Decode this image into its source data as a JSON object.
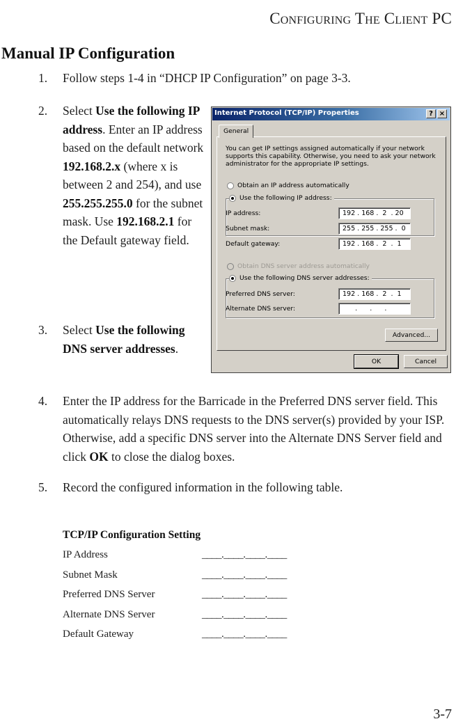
{
  "running_head": "Configuring The Client PC",
  "section_title": "Manual IP Configuration",
  "steps": [
    {
      "num": "1.",
      "parts": [
        {
          "t": "Follow steps 1-4 in “DHCP IP Configuration” on page 3-3."
        }
      ]
    },
    {
      "num": "2.",
      "parts": [
        {
          "t": "Select "
        },
        {
          "t": "Use the following IP address",
          "b": true
        },
        {
          "t": ". Enter an IP address based on the default network "
        },
        {
          "t": "192.168.2.x",
          "b": true
        },
        {
          "t": " (where x is between 2 and 254), and use "
        },
        {
          "t": "255.255.255.0",
          "b": true
        },
        {
          "t": " for the subnet mask. Use "
        },
        {
          "t": "192.168.2.1",
          "b": true
        },
        {
          "t": " for the Default gateway field."
        }
      ]
    },
    {
      "num": "3.",
      "parts": [
        {
          "t": "Select "
        },
        {
          "t": "Use the following DNS server addresses",
          "b": true
        },
        {
          "t": "."
        }
      ]
    },
    {
      "num": "4.",
      "parts": [
        {
          "t": "Enter the IP address for the Barricade in the Preferred DNS server field. This automatically relays DNS requests to the DNS server(s) provided by your ISP. Otherwise, add a specific DNS server into the Alternate DNS Server field and click "
        },
        {
          "t": "OK",
          "b": true
        },
        {
          "t": " to close the dialog boxes."
        }
      ]
    },
    {
      "num": "5.",
      "parts": [
        {
          "t": "Record the configured information in the following table."
        }
      ]
    }
  ],
  "dialog": {
    "title": "Internet Protocol (TCP/IP) Properties",
    "help_glyph": "?",
    "close_glyph": "×",
    "tab_label": "General",
    "intro": "You can get IP settings assigned automatically if your network supports this capability. Otherwise, you need to ask your network administrator for the appropriate IP settings.",
    "radio_obtain_ip": {
      "label": "Obtain an IP address automatically",
      "checked": false
    },
    "radio_use_ip": {
      "label": "Use the following IP address:",
      "checked": true
    },
    "ip_fields": [
      {
        "label": "IP address:",
        "value": "192 . 168 .  2  . 20"
      },
      {
        "label": "Subnet mask:",
        "value": "255 . 255 . 255 .  0"
      },
      {
        "label": "Default gateway:",
        "value": "192 . 168 .  2  .  1"
      }
    ],
    "radio_obtain_dns": {
      "label": "Obtain DNS server address automatically",
      "checked": false,
      "disabled": true
    },
    "radio_use_dns": {
      "label": "Use the following DNS server addresses:",
      "checked": true
    },
    "dns_fields": [
      {
        "label": "Preferred DNS server:",
        "value": "192 . 168 .  2  .  1"
      },
      {
        "label": "Alternate DNS server:",
        "value": "      .      .      ."
      }
    ],
    "advanced_label": "Advanced...",
    "ok_label": "OK",
    "cancel_label": "Cancel"
  },
  "record_table": {
    "heading": "TCP/IP Configuration Setting",
    "rows": [
      {
        "label": "IP Address",
        "blank": "____.____.____.____"
      },
      {
        "label": "Subnet Mask",
        "blank": "____.____.____.____"
      },
      {
        "label": "Preferred DNS Server",
        "blank": "____.____.____.____"
      },
      {
        "label": "Alternate DNS Server",
        "blank": "____.____.____.____"
      },
      {
        "label": "Default Gateway",
        "blank": "____.____.____.____"
      }
    ]
  },
  "page_number": "3-7"
}
